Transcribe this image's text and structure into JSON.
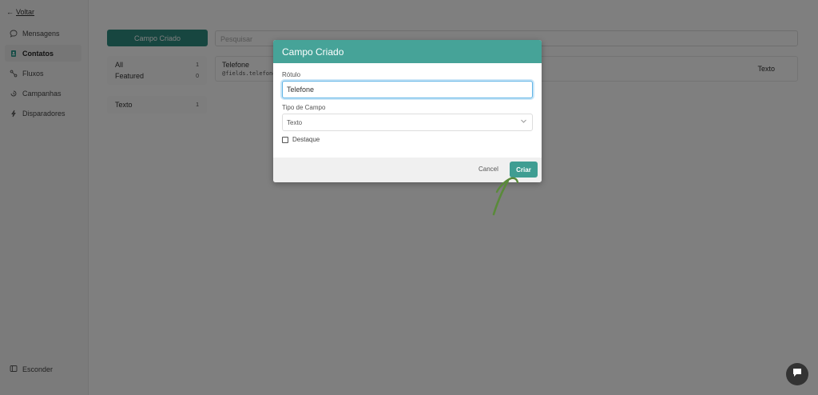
{
  "sidebar": {
    "back_label": "Voltar",
    "items": [
      {
        "label": "Mensagens",
        "icon": "chat-icon"
      },
      {
        "label": "Contatos",
        "icon": "contacts-icon"
      },
      {
        "label": "Fluxos",
        "icon": "flows-icon"
      },
      {
        "label": "Campanhas",
        "icon": "campaign-icon"
      },
      {
        "label": "Disparadores",
        "icon": "trigger-icon"
      }
    ],
    "active": "Contatos",
    "hide_label": "Esconder"
  },
  "main": {
    "create_field_button": "Campo Criado",
    "search": {
      "placeholder": "Pesquisar"
    },
    "filters": {
      "group1": [
        {
          "label": "All",
          "count": "1"
        },
        {
          "label": "Featured",
          "count": "0"
        }
      ],
      "group2": [
        {
          "label": "Texto",
          "count": "1"
        }
      ]
    },
    "field_card": {
      "name": "Telefone",
      "code": "@fields.telefone",
      "type": "Texto"
    }
  },
  "modal": {
    "title": "Campo Criado",
    "label_field_label": "Rótulo",
    "label_field_value": "Telefone",
    "type_field_label": "Tipo de Campo",
    "type_field_value": "Texto",
    "featured_checkbox_label": "Destaque",
    "cancel_label": "Cancel",
    "create_label": "Criar"
  },
  "colors": {
    "accent": "#46a398",
    "primary_button": "#2f8c80",
    "annotation": "#5a8a3a"
  }
}
